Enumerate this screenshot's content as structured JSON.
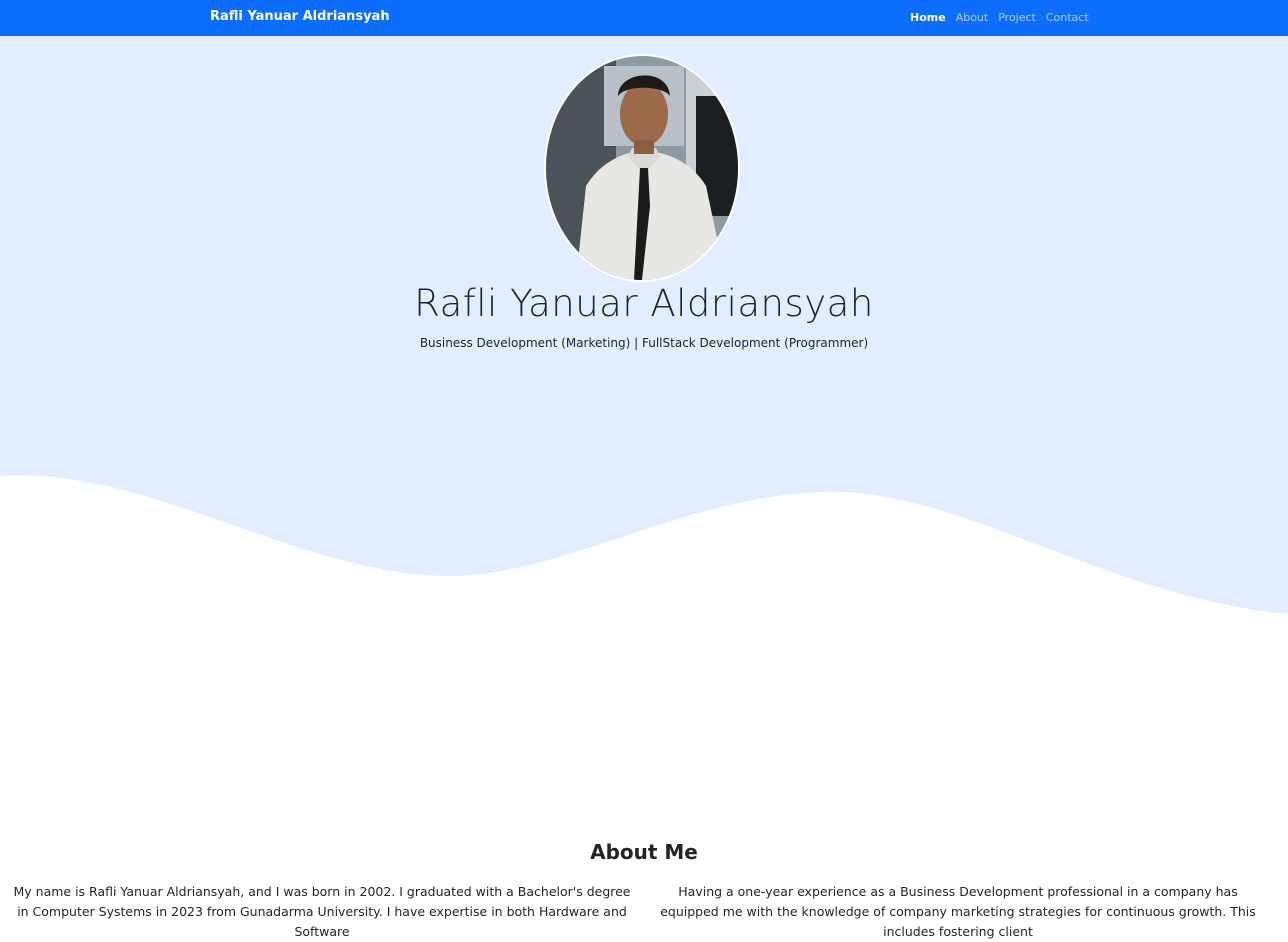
{
  "navbar": {
    "brand": "Rafli Yanuar Aldriansyah",
    "links": [
      {
        "label": "Home",
        "active": true
      },
      {
        "label": "About",
        "active": false
      },
      {
        "label": "Project",
        "active": false
      },
      {
        "label": "Contact",
        "active": false
      }
    ]
  },
  "hero": {
    "name": "Rafli Yanuar Aldriansyah",
    "subtitle": "Business Development (Marketing) | FullStack Development (Programmer)"
  },
  "about": {
    "title": "About Me",
    "left_text": "My name is Rafli Yanuar Aldriansyah, and I was born in 2002. I graduated with a Bachelor's degree in Computer Systems in 2023 from Gunadarma University. I have expertise in both Hardware and Software",
    "right_text": "Having a one-year experience as a Business Development professional in a company has equipped me with the knowledge of company marketing strategies for continuous growth. This includes fostering client"
  },
  "colors": {
    "primary": "#0d6efd",
    "hero_bg": "#e2edff"
  }
}
